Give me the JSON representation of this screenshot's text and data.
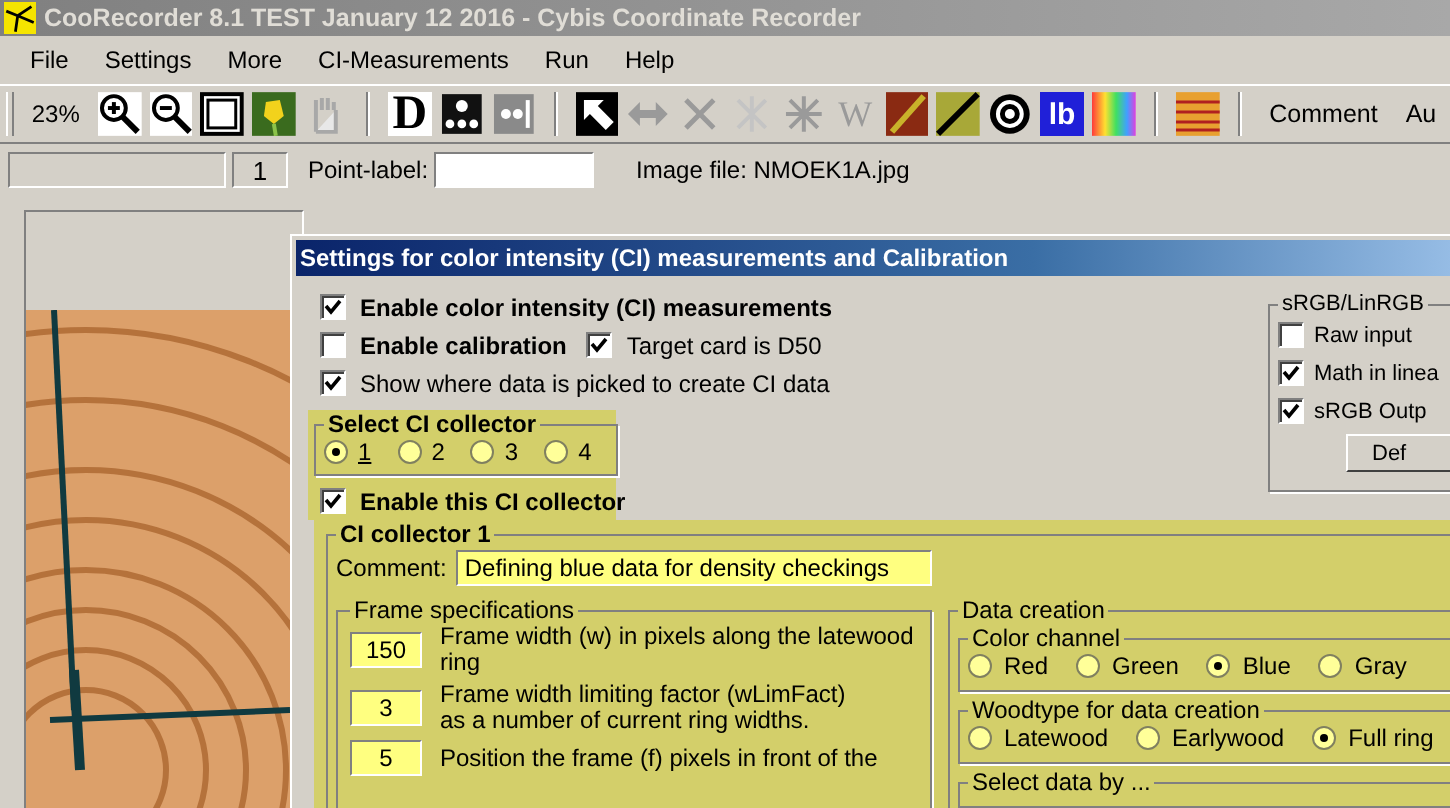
{
  "window": {
    "title": "CooRecorder 8.1 TEST January 12 2016 - Cybis Coordinate Recorder"
  },
  "menu": [
    "File",
    "Settings",
    "More",
    "CI-Measurements",
    "Run",
    "Help"
  ],
  "toolbar": {
    "zoom": "23%",
    "items": [
      {
        "kind": "zoom-in"
      },
      {
        "kind": "zoom-out"
      },
      {
        "kind": "square"
      },
      {
        "kind": "flower"
      },
      {
        "kind": "hand"
      },
      {
        "kind": "sep"
      },
      {
        "kind": "letter",
        "label": "D"
      },
      {
        "kind": "dots"
      },
      {
        "kind": "dots-grey"
      },
      {
        "kind": "sep"
      },
      {
        "kind": "arrow"
      },
      {
        "kind": "double-arrow"
      },
      {
        "kind": "cross"
      },
      {
        "kind": "cross-light"
      },
      {
        "kind": "asterisk"
      },
      {
        "kind": "letter-grey",
        "label": "W"
      },
      {
        "kind": "red-wood"
      },
      {
        "kind": "diagonal"
      },
      {
        "kind": "target"
      },
      {
        "kind": "letter-blue",
        "label": "lb"
      },
      {
        "kind": "color-wheel"
      },
      {
        "kind": "sep"
      },
      {
        "kind": "stripes"
      },
      {
        "kind": "sep"
      },
      {
        "kind": "text",
        "label": "Comment"
      },
      {
        "kind": "text",
        "label": "Au"
      }
    ]
  },
  "point_bar": {
    "counter": "1",
    "point_label": "Point-label:",
    "image_file": "Image file: NMOEK1A.jpg"
  },
  "dialog": {
    "title": "Settings for color intensity (CI) measurements and Calibration",
    "enable_ci": {
      "label": "Enable color intensity (CI) measurements",
      "checked": true
    },
    "enable_calibration": {
      "label": "Enable calibration",
      "checked": false
    },
    "target_card": {
      "label": "Target card is D50",
      "checked": true
    },
    "show_picked": {
      "label": "Show where data is picked to create CI data",
      "checked": true
    },
    "collector_select": {
      "legend": "Select CI collector",
      "options": [
        {
          "label": "1",
          "selected": true
        },
        {
          "label": "2",
          "selected": false
        },
        {
          "label": "3",
          "selected": false
        },
        {
          "label": "4",
          "selected": false
        }
      ]
    },
    "enable_collector": {
      "label": "Enable this CI collector",
      "checked": true
    },
    "srgb": {
      "legend": "sRGB/LinRGB",
      "options": [
        {
          "label": "Raw input",
          "checked": false
        },
        {
          "label": "Math in linea",
          "checked": true
        },
        {
          "label": "sRGB Outp",
          "checked": true
        }
      ],
      "button": "Def"
    },
    "collector": {
      "legend": "CI collector 1",
      "comment_label": "Comment:",
      "comment": "Defining blue data for density checkings",
      "frame": {
        "legend": "Frame specifications",
        "rows": [
          {
            "value": "150",
            "text": "Frame width (w) in pixels along the latewood ring"
          },
          {
            "value": "3",
            "text": "Frame width limiting factor (wLimFact)\nas a number of current ring widths."
          },
          {
            "value": "5",
            "text": "Position the frame (f)  pixels in front of the"
          }
        ]
      },
      "data_creation": {
        "legend": "Data creation",
        "channel": {
          "legend": "Color channel",
          "options": [
            {
              "label": "Red",
              "selected": false
            },
            {
              "label": "Green",
              "selected": false
            },
            {
              "label": "Blue",
              "selected": true
            },
            {
              "label": "Gray",
              "selected": false
            }
          ]
        },
        "woodtype": {
          "legend": "Woodtype for data creation",
          "options": [
            {
              "label": "Latewood",
              "selected": false
            },
            {
              "label": "Earlywood",
              "selected": false
            },
            {
              "label": "Full ring",
              "selected": true
            }
          ]
        },
        "select_by": {
          "legend": "Select data by ..."
        }
      }
    }
  }
}
